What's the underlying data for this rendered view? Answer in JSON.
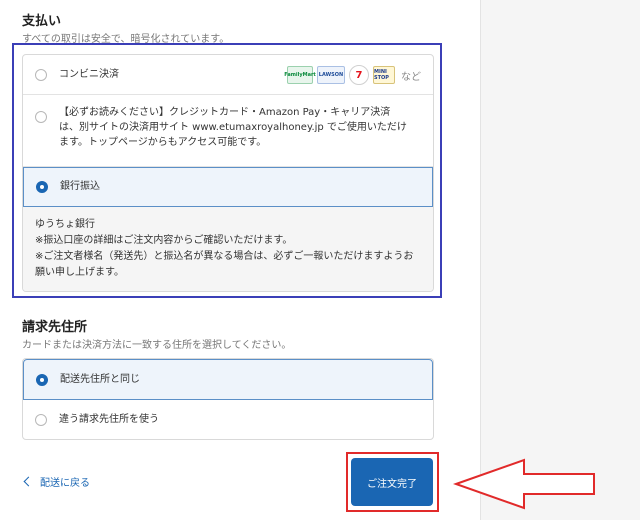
{
  "payment": {
    "title": "支払い",
    "subtitle": "すべての取引は安全で、暗号化されています。",
    "options": {
      "convenience": {
        "label": "コンビニ決済",
        "selected": false
      },
      "credit": {
        "label": "【必ずお読みください】クレジットカード・Amazon Pay・キャリア決済は、別サイトの決済用サイト www.etumaxroyalhoney.jp でご使用いただけます。トップページからもアクセス可能です。",
        "selected": false
      },
      "bank": {
        "label": "銀行振込",
        "selected": true
      }
    },
    "logos": {
      "familymart": "FamilyMart",
      "lawson": "LAWSON",
      "seven": "7",
      "ministop": "MINI STOP",
      "more": "など"
    },
    "bank_detail": {
      "line1": "ゆうちょ銀行",
      "line2": "※振込口座の詳細はご注文内容からご確認いただけます。",
      "line3": "※ご注文者様名（発送先）と振込名が異なる場合は、必ずご一報いただけますようお願い申し上げます。"
    }
  },
  "billing": {
    "title": "請求先住所",
    "subtitle": "カードまたは決済方法に一致する住所を選択してください。",
    "options": {
      "same": {
        "label": "配送先住所と同じ",
        "selected": true
      },
      "different": {
        "label": "違う請求先住所を使う",
        "selected": false
      }
    }
  },
  "footer": {
    "back_label": "配送に戻る",
    "complete_label": "ご注文完了"
  },
  "colors": {
    "accent": "#1a66b3",
    "annotation_blue": "#3b3fb7",
    "annotation_red": "#e12a2a"
  }
}
